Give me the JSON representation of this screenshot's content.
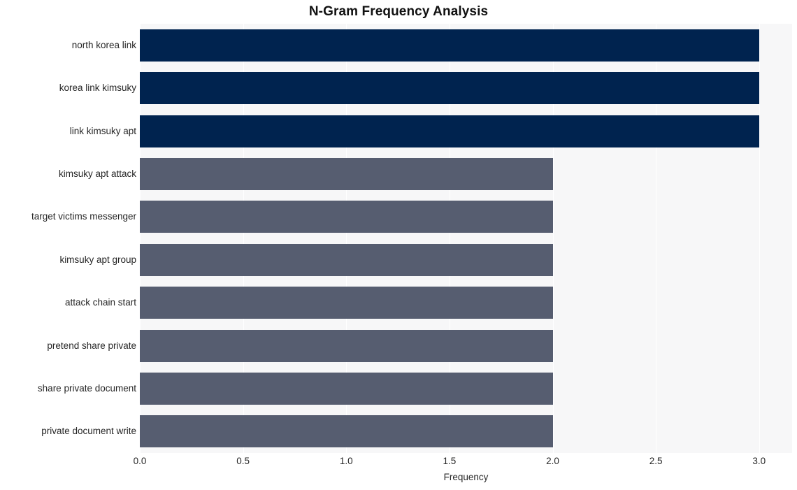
{
  "chart_data": {
    "type": "bar",
    "orientation": "horizontal",
    "title": "N-Gram Frequency Analysis",
    "xlabel": "Frequency",
    "ylabel": "",
    "categories": [
      "north korea link",
      "korea link kimsuky",
      "link kimsuky apt",
      "kimsuky apt attack",
      "target victims messenger",
      "kimsuky apt group",
      "attack chain start",
      "pretend share private",
      "share private document",
      "private document write"
    ],
    "values": [
      3,
      3,
      3,
      2,
      2,
      2,
      2,
      2,
      2,
      2
    ],
    "bar_colors": [
      "#00234f",
      "#00234f",
      "#00234f",
      "#565d70",
      "#565d70",
      "#565d70",
      "#565d70",
      "#565d70",
      "#565d70",
      "#565d70"
    ],
    "xlim": [
      0.0,
      3.16
    ],
    "xticks": [
      0.0,
      0.5,
      1.0,
      1.5,
      2.0,
      2.5,
      3.0
    ],
    "xtick_labels": [
      "0.0",
      "0.5",
      "1.0",
      "1.5",
      "2.0",
      "2.5",
      "3.0"
    ],
    "grid": true,
    "grid_axis": "x",
    "grid_color": "#ffffff",
    "legend": false,
    "plot_background": "#f7f7f8",
    "figure_background": "#ffffff",
    "title_color": "#111111",
    "tick_label_color": "#262626"
  }
}
